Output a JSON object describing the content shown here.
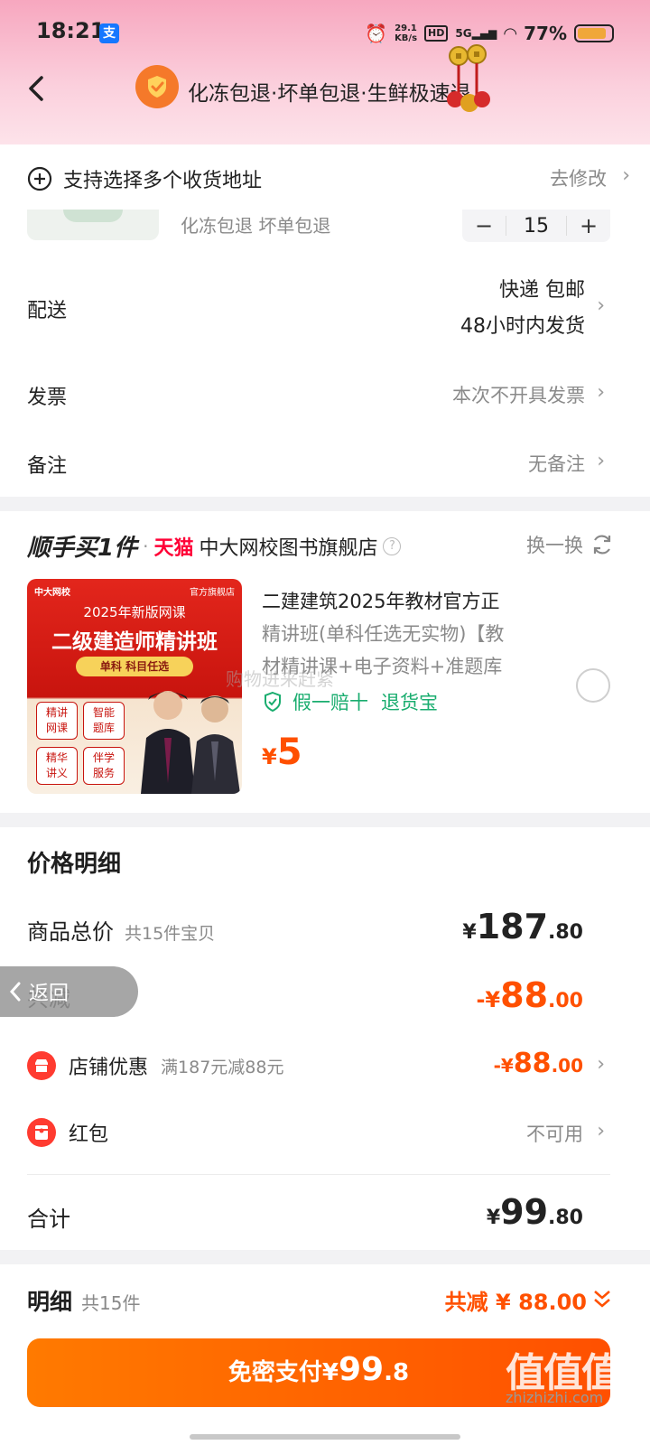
{
  "status": {
    "time": "18:21",
    "alipay": "支",
    "net_speed": "29.1",
    "net_unit": "KB/s",
    "hd": "HD",
    "net_type": "5G",
    "battery": "77%",
    "battery_level": 0.77
  },
  "header": {
    "title": "化冻包退·坏单包退·生鲜极速退"
  },
  "address": {
    "label": "支持选择多个收货地址",
    "action": "去修改"
  },
  "item": {
    "tags": "化冻包退 坏单包退",
    "quantity": "15",
    "minus": "−",
    "plus": "+"
  },
  "delivery": {
    "label": "配送",
    "line1": "快递 包邮",
    "line2": "48小时内发货"
  },
  "invoice": {
    "label": "发票",
    "value": "本次不开具发票"
  },
  "remark": {
    "label": "备注",
    "value": "无备注"
  },
  "addon": {
    "title": "顺手买1件",
    "tmall": "天猫",
    "shop": "中大网校图书旗舰店",
    "swap": "换一换",
    "product": {
      "title_line1": "二建建筑2025年教材官方正",
      "title_line2": "精讲班(单科任选无实物)【教",
      "title_line3": "材精讲课+电子资料+准题库",
      "badge1": "假一赔十",
      "badge2": "退货宝",
      "currency": "¥",
      "price": "5",
      "watermark": "购物进来赶紧"
    },
    "thumb": {
      "brand": "中大网校",
      "store": "官方旗舰店",
      "line1": "2025年新版网课",
      "line2": "二级建造师精讲班",
      "line3": "单科 科目任选",
      "tag1": "精讲\n网课",
      "tag2": "智能\n题库",
      "tag3": "精华\n讲义",
      "tag4": "伴学\n服务"
    }
  },
  "price_detail": {
    "heading": "价格明细",
    "total_label": "商品总价",
    "total_count": "共15件宝贝",
    "total_currency": "¥",
    "total_int": "187",
    "total_dec": ".80",
    "discount_label": "共减",
    "discount_prefix": "-¥",
    "discount_int": "88",
    "discount_dec": ".00",
    "shop_label": "店铺优惠",
    "shop_rule": "满187元减88元",
    "shop_prefix": "-¥",
    "shop_int": "88",
    "shop_dec": ".00",
    "redpacket_label": "红包",
    "redpacket_value": "不可用",
    "sum_label": "合计",
    "sum_currency": "¥",
    "sum_int": "99",
    "sum_dec": ".80"
  },
  "floating_back": {
    "label": "返回"
  },
  "footer": {
    "detail_label": "明细",
    "detail_count": "共15件",
    "saved": "共减 ¥ 88.00",
    "pay_label": "免密支付¥",
    "pay_int": "99",
    "pay_dec": ".8"
  },
  "watermark_site": {
    "logo": "值值值",
    "url": "zhizhizhi.com"
  },
  "colors": {
    "accent": "#ff5000",
    "pay_button": "#ff5b00",
    "header_pink": "#f7a7bf",
    "verify_green": "#1aad6f"
  }
}
